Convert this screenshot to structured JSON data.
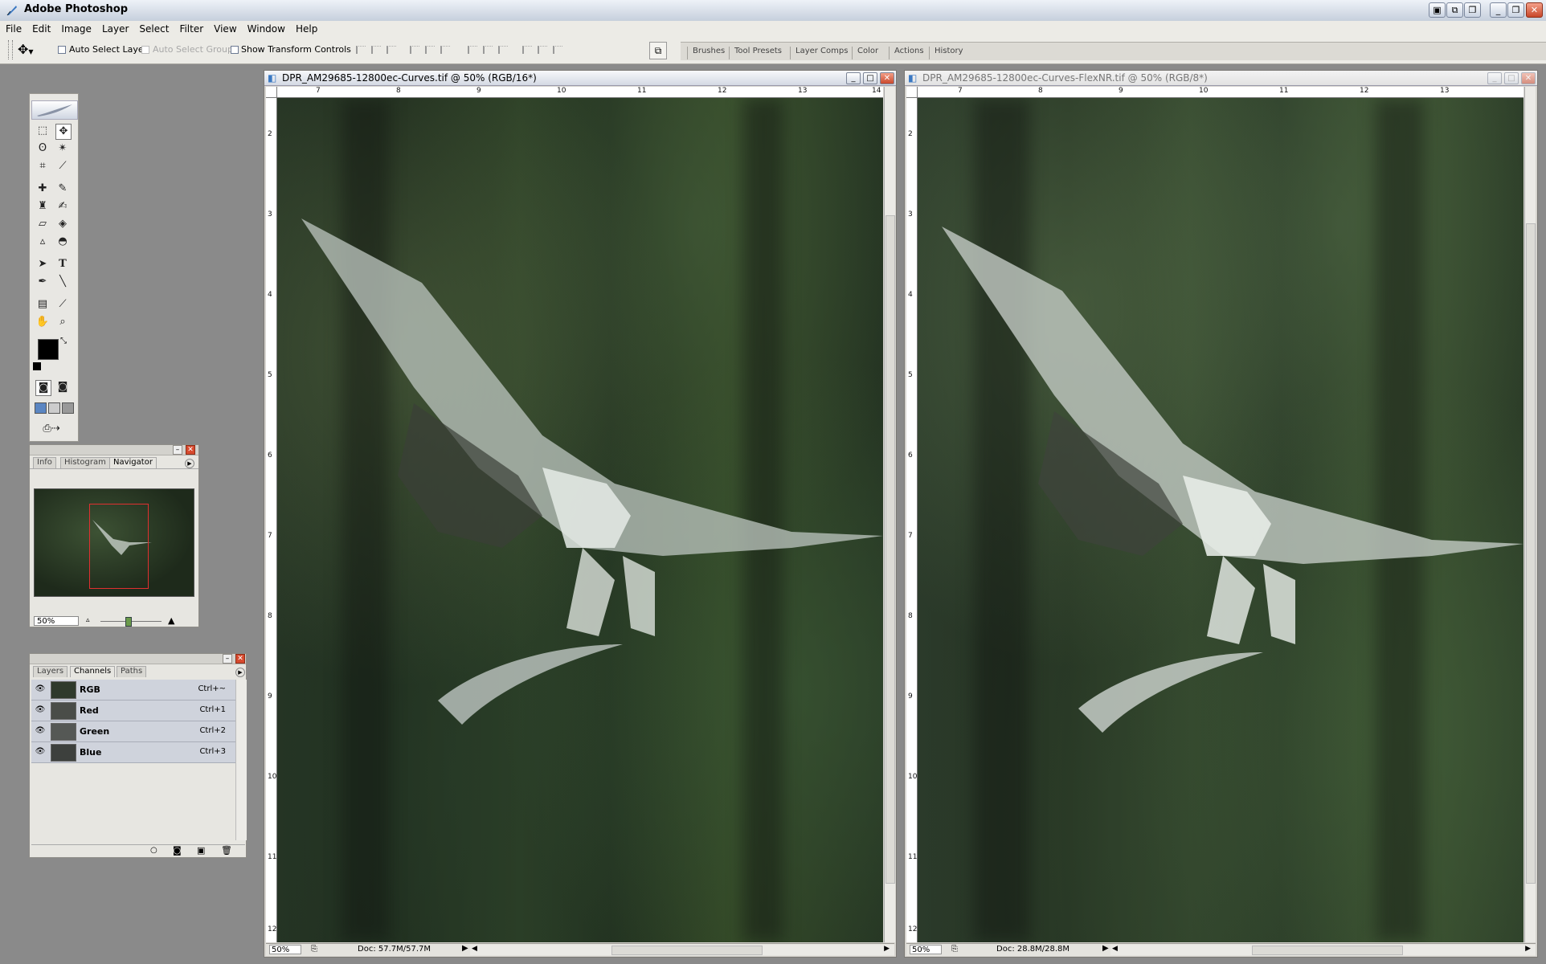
{
  "app": {
    "title": "Adobe Photoshop"
  },
  "menu": [
    "File",
    "Edit",
    "Image",
    "Layer",
    "Select",
    "Filter",
    "View",
    "Window",
    "Help"
  ],
  "options": {
    "auto_select_layer": "Auto Select Layer",
    "auto_select_groups": "Auto Select Groups",
    "show_transform_controls": "Show Transform Controls"
  },
  "palette_well": [
    "Brushes",
    "Tool Presets",
    "Layer Comps",
    "Color",
    "Actions",
    "History"
  ],
  "navigator": {
    "tabs": [
      "Info",
      "Histogram",
      "Navigator"
    ],
    "zoom": "50%"
  },
  "channels": {
    "tabs": [
      "Layers",
      "Channels",
      "Paths"
    ],
    "rows": [
      {
        "name": "RGB",
        "shortcut": "Ctrl+~"
      },
      {
        "name": "Red",
        "shortcut": "Ctrl+1"
      },
      {
        "name": "Green",
        "shortcut": "Ctrl+2"
      },
      {
        "name": "Blue",
        "shortcut": "Ctrl+3"
      }
    ]
  },
  "doc1": {
    "title": "DPR_AM29685-12800ec-Curves.tif @ 50% (RGB/16*)",
    "zoom": "50%",
    "doc_size": "Doc: 57.7M/57.7M",
    "ruler_h": [
      "7",
      "8",
      "9",
      "10",
      "11",
      "12",
      "13",
      "14"
    ],
    "ruler_v": [
      "2",
      "3",
      "4",
      "5",
      "6",
      "7",
      "8",
      "9",
      "10",
      "11",
      "12"
    ]
  },
  "doc2": {
    "title": "DPR_AM29685-12800ec-Curves-FlexNR.tif @ 50% (RGB/8*)",
    "zoom": "50%",
    "doc_size": "Doc: 28.8M/28.8M",
    "ruler_h": [
      "7",
      "8",
      "9",
      "10",
      "11",
      "12",
      "13"
    ],
    "ruler_v": [
      "2",
      "3",
      "4",
      "5",
      "6",
      "7",
      "8",
      "9",
      "10",
      "11",
      "12"
    ]
  },
  "colors": {
    "title_bar": "#c6cfdc",
    "workspace": "#8a8a8a",
    "nav_box": "#e03030",
    "close_button": "#c8472a"
  }
}
